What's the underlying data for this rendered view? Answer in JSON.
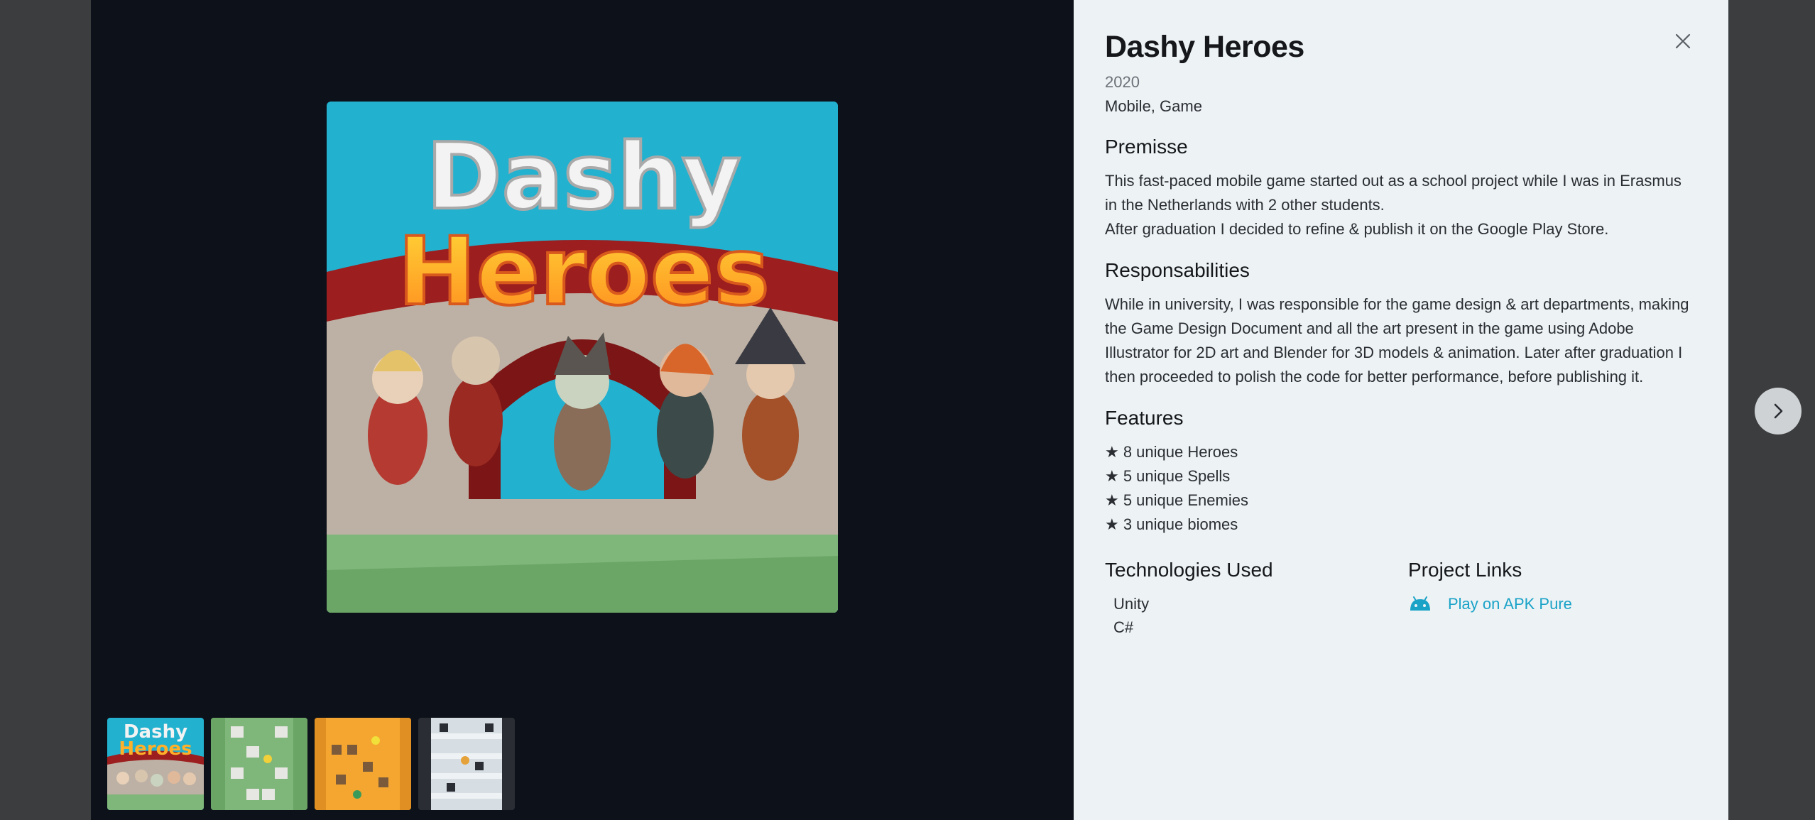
{
  "project": {
    "title": "Dashy Heroes",
    "year": "2020",
    "categories": "Mobile, Game"
  },
  "sections": {
    "premise": {
      "heading": "Premisse",
      "paragraph1": "This fast-paced mobile game started out as a school project while I was in Erasmus in the Netherlands with 2 other students.",
      "paragraph2": "After graduation I decided to refine & publish it on the Google Play Store."
    },
    "responsibilities": {
      "heading": "Responsabilities",
      "paragraph": "While in university, I was responsible for the game design & art departments, making the Game Design Document and all the art present in the game using Adobe Illustrator for 2D art and Blender for 3D models & animation. Later after graduation I then proceeded to polish the code for better performance, before publishing it."
    },
    "features": {
      "heading": "Features",
      "items": [
        "★ 8 unique Heroes",
        "★ 5 unique Spells",
        "★ 5 unique Enemies",
        "★ 3 unique biomes"
      ]
    },
    "technologies": {
      "heading": "Technologies Used",
      "items": [
        "Unity",
        "C#"
      ]
    },
    "links": {
      "heading": "Project Links",
      "items": [
        {
          "label": "Play on APK Pure",
          "icon": "android-icon"
        }
      ]
    }
  },
  "main_image": {
    "logo_line1": "Dashy",
    "logo_line2": "Heroes"
  },
  "thumbnails": [
    {
      "icon": "thumbnail-key-art",
      "logo_line1": "Dashy",
      "logo_line2": "Heroes"
    },
    {
      "icon": "thumbnail-grass-level"
    },
    {
      "icon": "thumbnail-desert-level"
    },
    {
      "icon": "thumbnail-snow-level"
    }
  ],
  "icons": {
    "close": "close-icon",
    "next": "chevron-right-icon"
  },
  "colors": {
    "gallery_bg": "#0d1119",
    "panel_bg": "#edf2f5",
    "link": "#1aa3c7"
  }
}
